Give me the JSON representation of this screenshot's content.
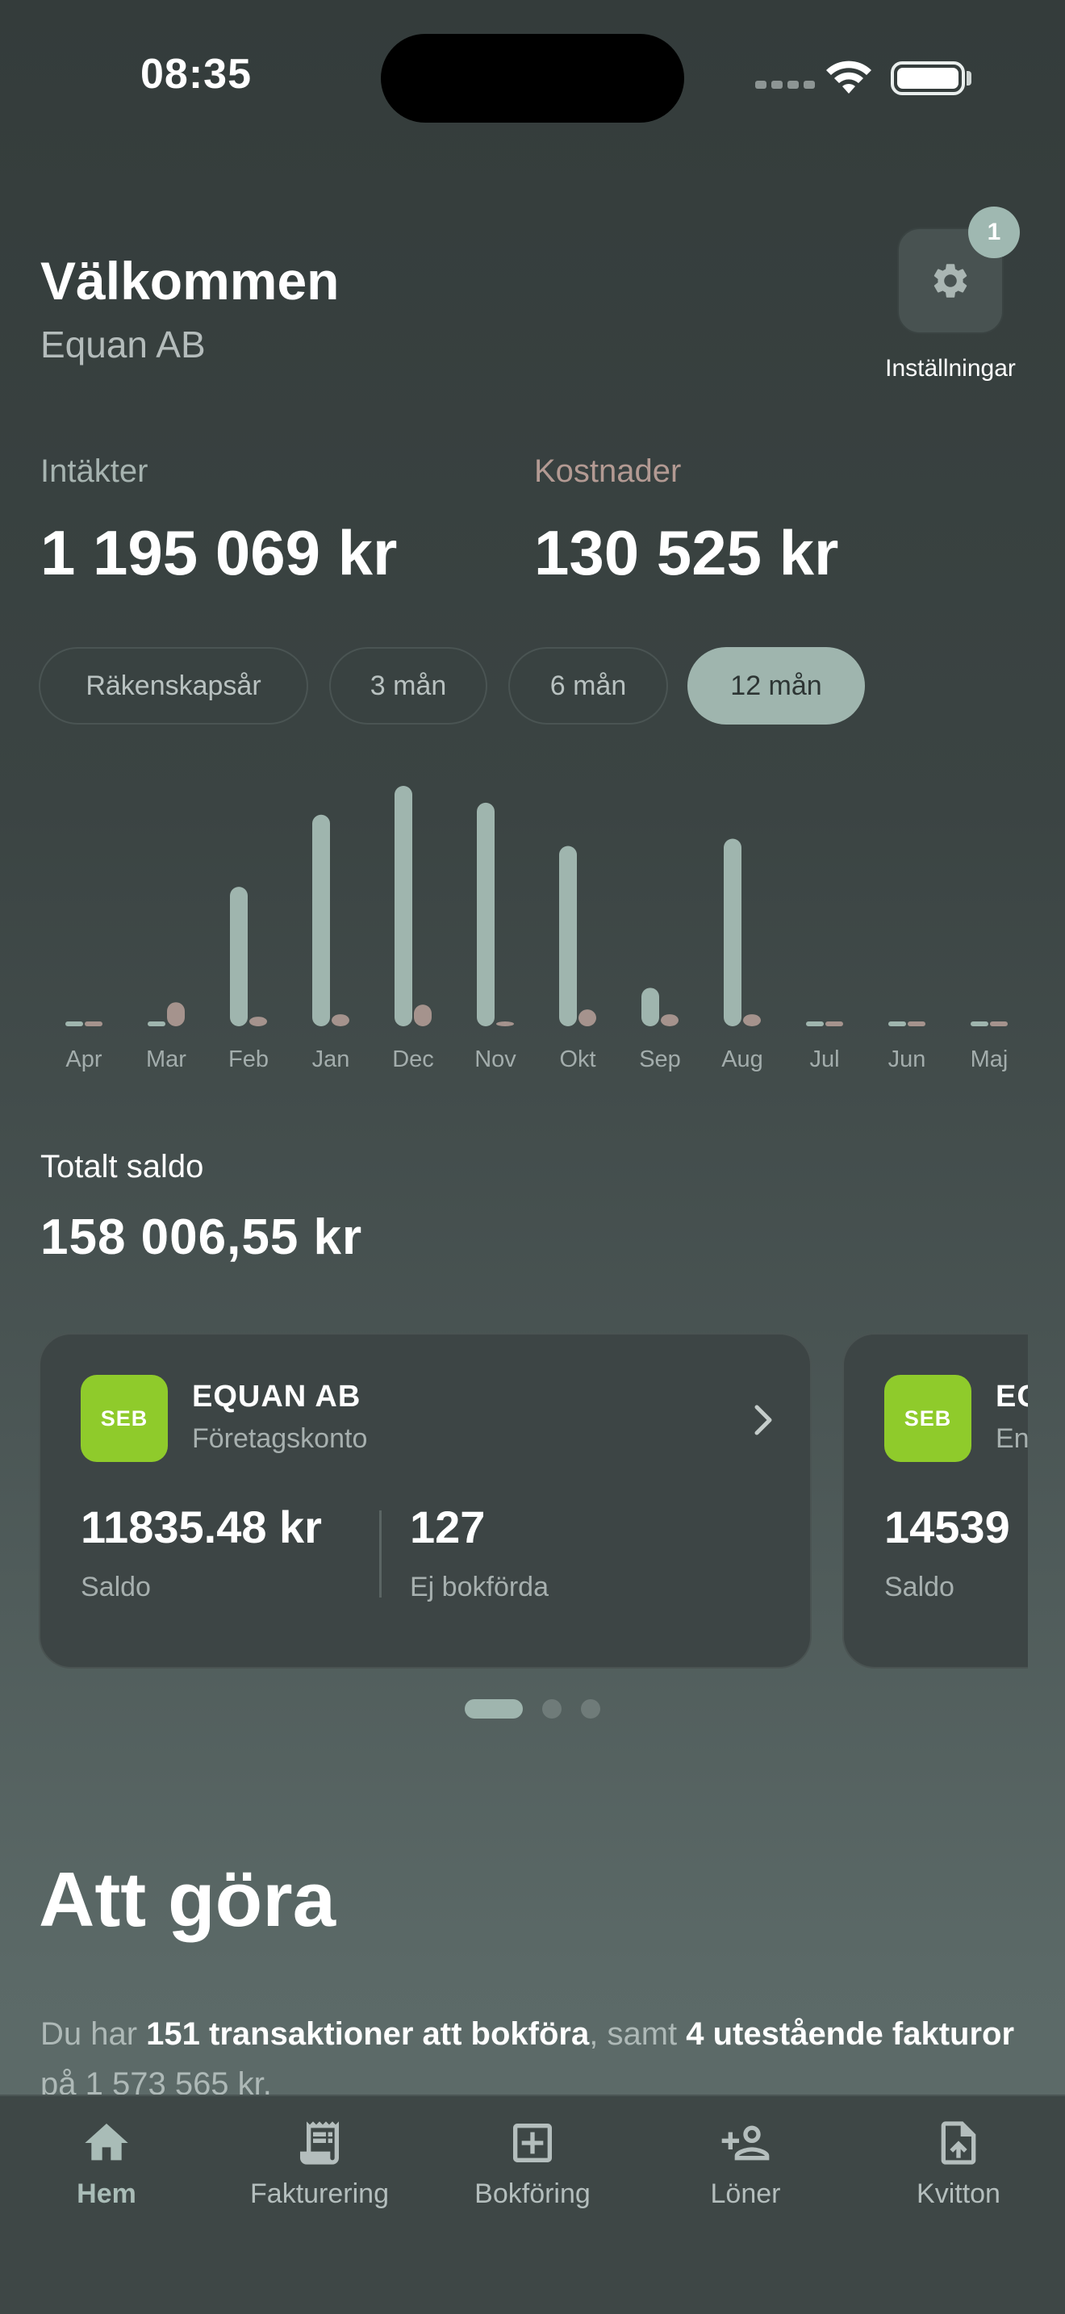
{
  "status_bar": {
    "time": "08:35"
  },
  "header": {
    "title": "Välkommen",
    "company": "Equan AB",
    "settings_label": "Inställningar",
    "settings_badge": "1"
  },
  "totals": {
    "income_label": "Intäkter",
    "income_value": "1 195 069 kr",
    "costs_label": "Kostnader",
    "costs_value": "130 525 kr"
  },
  "periods": [
    {
      "label": "Räkenskapsår",
      "active": false
    },
    {
      "label": "3 mån",
      "active": false
    },
    {
      "label": "6 mån",
      "active": false
    },
    {
      "label": "12 mån",
      "active": true
    }
  ],
  "chart_data": {
    "type": "bar",
    "categories": [
      "Apr",
      "Mar",
      "Feb",
      "Jan",
      "Dec",
      "Nov",
      "Okt",
      "Sep",
      "Aug",
      "Jul",
      "Jun",
      "Maj"
    ],
    "series": [
      {
        "values": [
          0,
          0,
          58,
          88,
          100,
          93,
          75,
          16,
          78,
          0,
          0,
          0
        ],
        "color": "#9fb5ae"
      },
      {
        "values": [
          0,
          10,
          4,
          5,
          9,
          2,
          7,
          5,
          5,
          0,
          0,
          0
        ],
        "color": "#a5938d"
      }
    ],
    "ylim": [
      0,
      100
    ],
    "grid": false
  },
  "balance": {
    "label": "Totalt saldo",
    "value": "158 006,55 kr"
  },
  "accounts": [
    {
      "logo": "SEB",
      "name": "EQUAN AB",
      "type": "Företagskonto",
      "balance": "11835.48 kr",
      "balance_label": "Saldo",
      "unbooked": "127",
      "unbooked_label": "Ej bokförda"
    },
    {
      "logo": "SEB",
      "name": "EC",
      "type": "En",
      "balance": "14539",
      "balance_label": "Saldo"
    }
  ],
  "todo": {
    "title": "Att göra",
    "t1": "Du har ",
    "b1": "151 transaktioner att bokföra",
    "t2": ", samt ",
    "b2": "4 utestående fakturor",
    "t3": " på 1 573 565 kr."
  },
  "tabs": [
    {
      "label": "Hem",
      "icon": "home-icon",
      "active": true
    },
    {
      "label": "Fakturering",
      "icon": "invoice-icon",
      "active": false
    },
    {
      "label": "Bokföring",
      "icon": "plus-square-icon",
      "active": false
    },
    {
      "label": "Löner",
      "icon": "person-add-icon",
      "active": false
    },
    {
      "label": "Kvitton",
      "icon": "upload-file-icon",
      "active": false
    }
  ],
  "colors": {
    "accent": "#9fb5ae",
    "cost": "#a5938d",
    "seb_green": "#8fcb2b"
  }
}
